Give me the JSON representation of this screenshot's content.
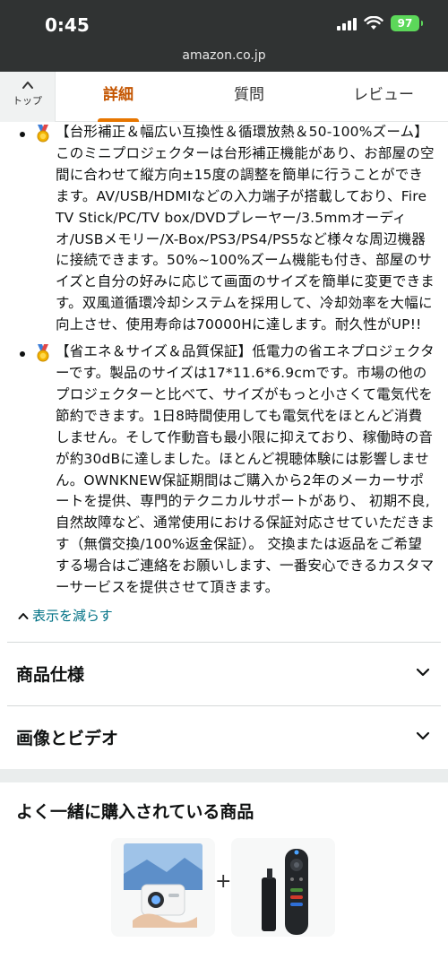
{
  "status_bar": {
    "time": "0:45",
    "battery": "97"
  },
  "browser": {
    "url": "amazon.co.jp"
  },
  "tabs": {
    "top_label": "トップ",
    "items": [
      {
        "label": "詳細",
        "active": true
      },
      {
        "label": "質問",
        "active": false
      },
      {
        "label": "レビュー",
        "active": false
      }
    ]
  },
  "bullets": [
    {
      "icon": "medal-icon",
      "text": "【台形補正＆幅広い互換性＆循環放熱＆50-100%ズーム】このミニプロジェクターは台形補正機能があり、お部屋の空間に合わせて縦方向±15度の調整を簡単に行うことができます。AV/USB/HDMIなどの入力端子が搭載しており、Fire TV Stick/PC/TV box/DVDプレーヤー/3.5mmオーディオ/USBメモリー/X-Box/PS3/PS4/PS5など様々な周辺機器に接続できます。50%~100%ズーム機能も付き、部屋のサイズと自分の好みに応じて画面のサイズを簡単に変更できます。双風道循環冷却システムを採用して、冷却効率を大幅に向上させ、使用寿命は70000Hに達します。耐久性がUP!!"
    },
    {
      "icon": "medal-icon",
      "text": "【省エネ＆サイズ＆品質保証】低電力の省エネプロジェクターです。製品のサイズは17*11.6*6.9cmです。市場の他のプロジェクターと比べて、サイズがもっと小さくて電気代を節約できます。1日8時間使用しても電気代をほとんど消費しません。そして作動音も最小限に抑えており、稼働時の音が約30dBに達しました。ほとんど視聴体験には影響しません。OWNKNEW保証期間はご購入から2年のメーカーサポートを提供、専門的テクニカルサポートがあり、 初期不良, 自然故障など、通常使用における保証対応させていただきます（無償交換/100%返金保証）。 交換または返品をご希望する場合はご連絡をお願いします、一番安心できるカスタマーサービスを提供させて頂きます。"
    }
  ],
  "show_less": "表示を減らす",
  "accordions": [
    {
      "label": "商品仕様"
    },
    {
      "label": "画像とビデオ"
    }
  ],
  "frequently_bought": {
    "title": "よく一緒に購入されている商品",
    "plus": "+"
  },
  "colors": {
    "accent_orange": "#c45500",
    "tab_underline": "#e77600",
    "link": "#007185",
    "status_bar": "#303333"
  }
}
